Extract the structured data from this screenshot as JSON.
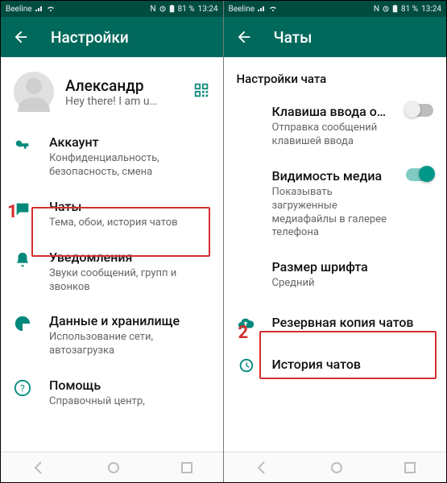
{
  "status": {
    "carrier": "Beeline",
    "battery": "81 %",
    "time": "13:24",
    "nfc": "N"
  },
  "left": {
    "title": "Настройки",
    "profile": {
      "name": "Александр",
      "status": "Hey there! I am u…"
    },
    "items": [
      {
        "title": "Аккаунт",
        "sub": "Конфиденциальность, безопасность, смена"
      },
      {
        "title": "Чаты",
        "sub": "Тема, обои, история чатов"
      },
      {
        "title": "Уведомления",
        "sub": "Звуки сообщений, групп и звонков"
      },
      {
        "title": "Данные и хранилище",
        "sub": "Использование сети, автозагрузка"
      },
      {
        "title": "Помощь",
        "sub": "Справочный центр,"
      }
    ],
    "annotation": "1"
  },
  "right": {
    "title": "Чаты",
    "section": "Настройки чата",
    "items": [
      {
        "title": "Клавиша ввода о…",
        "sub": "Отправка сообщений клавишей ввода",
        "toggle": false
      },
      {
        "title": "Видимость медиа",
        "sub": "Показывать загруженные медиафайлы в галерее телефона",
        "toggle": true
      },
      {
        "title": "Размер шрифта",
        "sub": "Средний"
      },
      {
        "title": "Резервная копия чатов"
      },
      {
        "title": "История чатов"
      }
    ],
    "annotation": "2"
  }
}
